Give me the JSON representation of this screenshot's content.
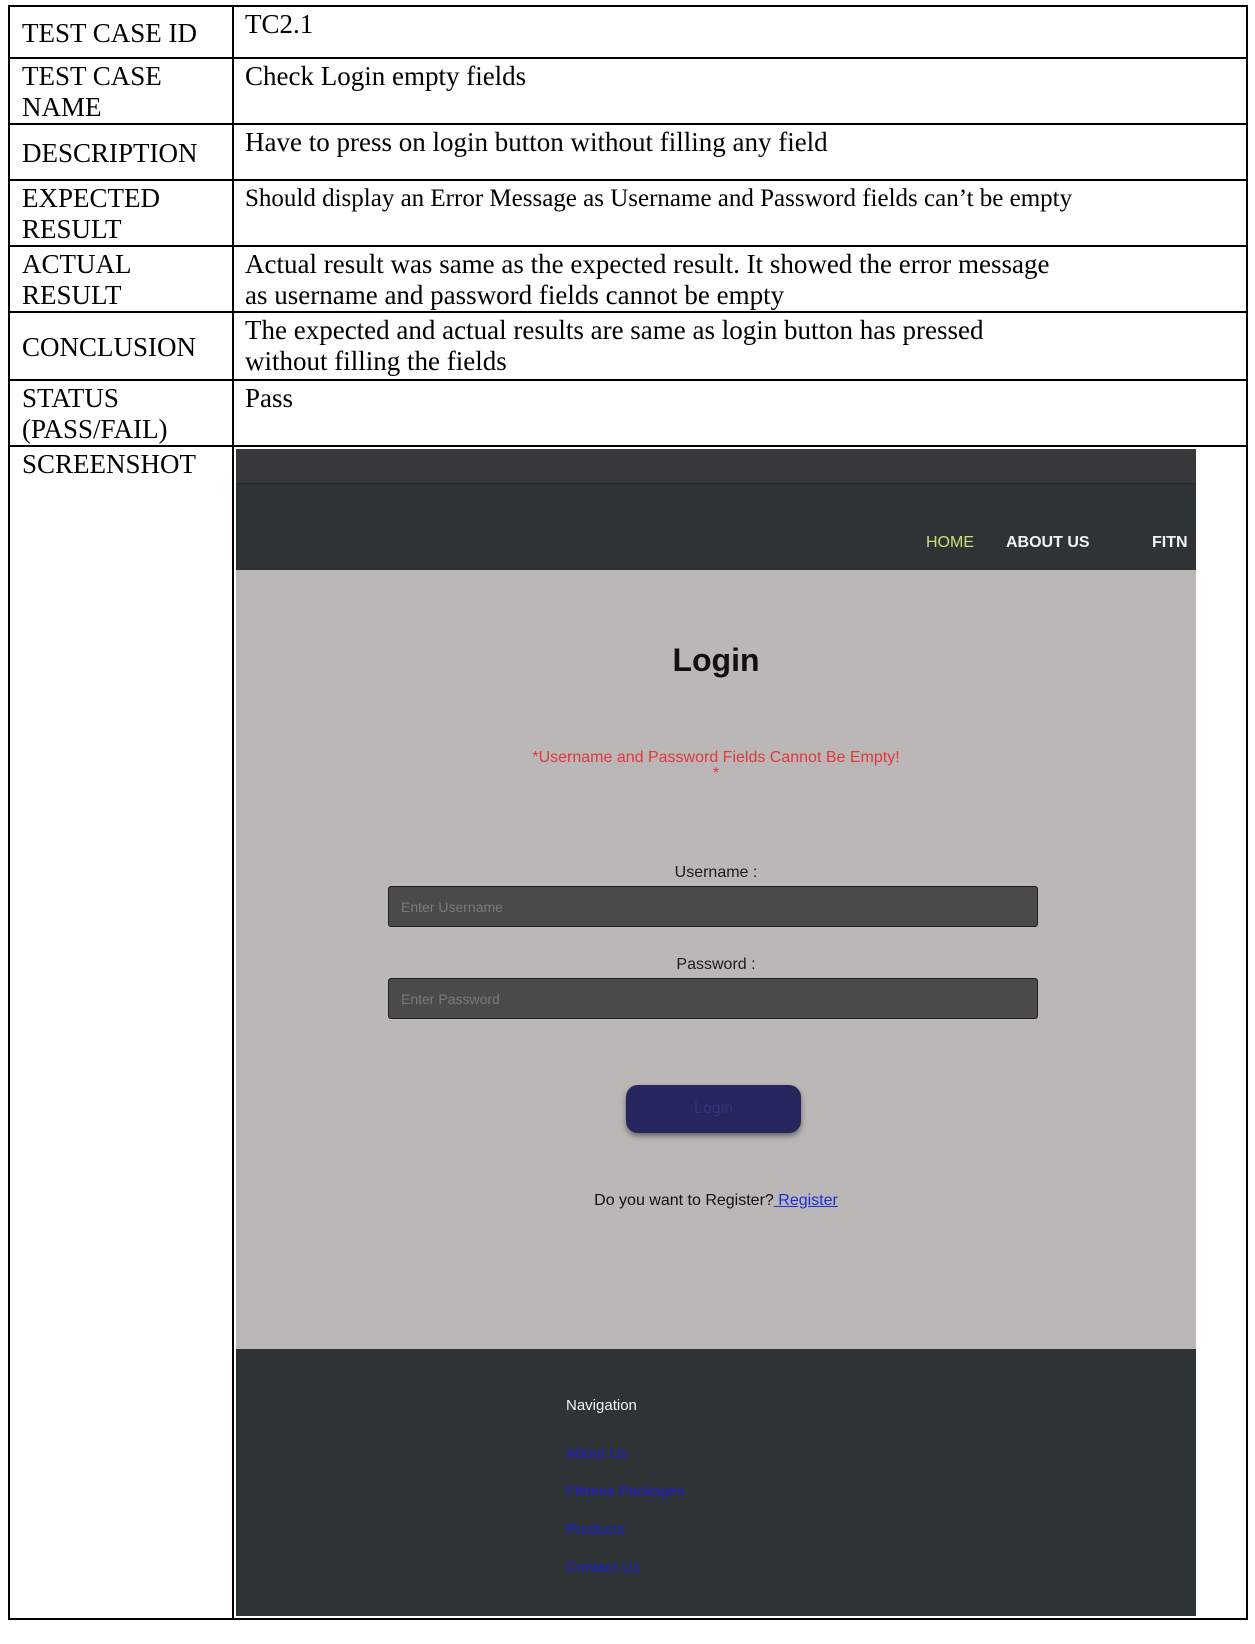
{
  "rows": {
    "id": {
      "label": "TEST CASE ID",
      "value": "TC2.1"
    },
    "name": {
      "label_1": "TEST CASE",
      "label_2": "NAME",
      "value": "Check Login empty fields"
    },
    "description": {
      "label": "DESCRIPTION",
      "value": "Have to press on login button without filling any field"
    },
    "expected": {
      "label_1": "EXPECTED",
      "label_2": "RESULT",
      "value": "Should display an Error Message as Username and Password fields can’t be empty"
    },
    "actual": {
      "label_1": "ACTUAL",
      "label_2": "RESULT",
      "value_1": "Actual result was same as the expected result. It showed the error message",
      "value_2": "as username and password fields cannot be empty"
    },
    "conclusion": {
      "label": "CONCLUSION",
      "value_1": "The expected and actual results are same as login button has pressed",
      "value_2": "without filling the fields"
    },
    "status": {
      "label_1": "STATUS",
      "label_2": "(PASS/FAIL)",
      "value": "Pass"
    },
    "screenshot": {
      "label": "SCREENSHOT"
    }
  },
  "screenshot": {
    "nav": {
      "home": "HOME",
      "about": "ABOUT US",
      "fitness": "FITN"
    },
    "title": "Login",
    "error": "*Username and Password Fields Cannot Be Empty!",
    "error_mark": "*",
    "username_label": "Username :",
    "username_placeholder": "Enter Username",
    "password_label": "Password :",
    "password_placeholder": "Enter Password",
    "login_button": "Login",
    "register_prompt": "Do you want to Register?",
    "register_link": " Register",
    "footer": {
      "title": "Navigation",
      "links": [
        "About Us",
        "Fitness Packages",
        "Products",
        "Contact Us"
      ]
    }
  },
  "colors": {
    "nav_bg": "#2e3436",
    "nav_active": "#c9e07a",
    "main_bg": "#bbb7b6",
    "error": "#e0393f",
    "input_bg": "#4a4a47",
    "button_bg": "#27255e",
    "link": "#1d2dd8"
  }
}
